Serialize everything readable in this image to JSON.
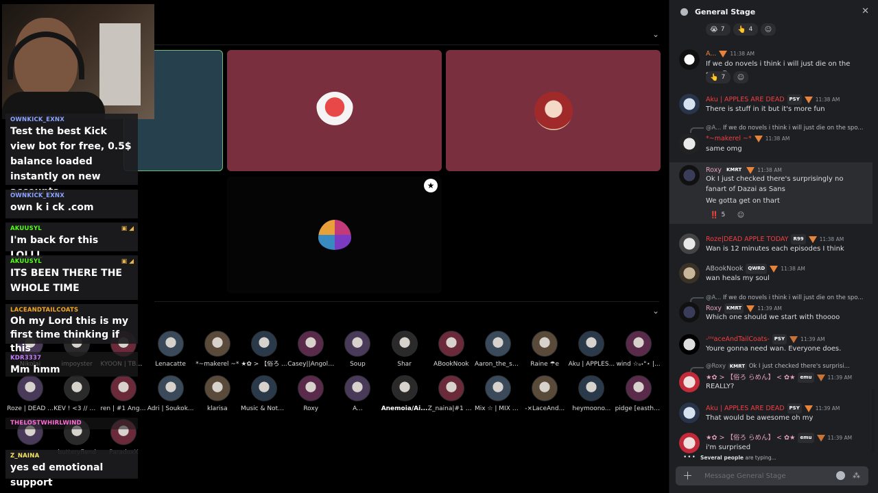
{
  "panel": {
    "title": "General Stage",
    "composer_placeholder": "Message General Stage",
    "typing_bold": "Several people",
    "typing_rest": "are typing..."
  },
  "top_reactions": [
    {
      "emoji": "😭",
      "count": "7"
    },
    {
      "emoji": "👆",
      "count": "4"
    }
  ],
  "messages": [
    {
      "name": "A...",
      "time": "11:38 AM",
      "text": "If we do novels i think i will just die on the spot😭",
      "reactions": [
        {
          "emoji": "👆",
          "count": "7"
        }
      ]
    },
    {
      "name": "Aku | APPLES ARE DEAD",
      "tag": "PSY",
      "time": "11:38 AM",
      "text": "There is stuff in it but it's more fun"
    },
    {
      "reply_name": "@A...",
      "reply_text": "If we do novels i think i will just die on the spo...",
      "name": "*~makerel ~*",
      "time": "11:38 AM",
      "text": "same omg"
    },
    {
      "name": "Roxy",
      "tag": "KMRT",
      "time": "11:38 AM",
      "text": "Ok I just checked there's surprisingly no fanart of Dazai as Sans",
      "text2": "We gotta get on thart",
      "reactions": [
        {
          "emoji": "‼️",
          "count": "5"
        }
      ]
    },
    {
      "name": "Roze|DEAD APPLE TODAY",
      "tag": "R99",
      "time": "11:38 AM",
      "text": "Wan is 12 minutes each episodes I think"
    },
    {
      "name": "ABookNook",
      "tag": "QWRD",
      "time": "11:38 AM",
      "text": "wan heals my soul"
    },
    {
      "reply_name": "@A...",
      "reply_text": "If we do novels i think i will just die on the spo...",
      "name": "Roxy",
      "tag": "KMRT",
      "time": "11:39 AM",
      "text": "Which one should we start with thoooo"
    },
    {
      "name": "-ᵗʰˡaceAndTailCoats-",
      "tag": "PSY",
      "time": "11:39 AM",
      "text": "Youre gonna need wan. Everyone does."
    },
    {
      "reply_name": "@Roxy",
      "reply_tag": "KMRT",
      "reply_text": "Ok I just checked there's surprisi...",
      "name": "★✿ > 【俗ろ らめん】 < ✿★",
      "tag": "emu",
      "time": "11:39 AM",
      "text": "REALLY?"
    },
    {
      "name": "Aku | APPLES ARE DEAD",
      "tag": "PSY",
      "time": "11:39 AM",
      "text": "That would be awesome oh my"
    },
    {
      "name": "★✿ > 【俗ろ らめん】 < ✿★",
      "tag": "emu",
      "time": "11:39 AM",
      "text": "i'm surprised"
    }
  ],
  "audience_row1": [
    "Nikolai",
    "impoyster",
    "KYOON | TBm...",
    "Lenacatte",
    "*~makerel ~*",
    "★✿ > 【俗ろ ...",
    "Casey||Angoli...",
    "Soup",
    "Shar",
    "ABookNook",
    "Aaron_the_sh...",
    "Raine ☂︎e",
    "Aku | APPLES...",
    "wind ☆ₒ˖°⋆ |..."
  ],
  "audience_row2": [
    "Roze | DEAD ...",
    "KEV ! <3 // MI...",
    "ren | #1 Angoli...",
    "Adri | Soukok...",
    "klarisa",
    "Music & Note...",
    "Roxy",
    "A...",
    "Anemoia/Ai...",
    "Z_naina|#1 Ed...",
    "Mix ☆ | MIX D...",
    "-×LaceAnd...",
    "heymoono...",
    "pidge [easthie..."
  ],
  "audience_row3": [
    "",
    "butteryfiend",
    "ParadoxX"
  ],
  "kick_chat": [
    {
      "user": "OWNKICK_EXNX",
      "text": "Test the best Kick view bot for free, 0.5$ balance loaded instantly on new accounts",
      "color": "#8aa4ff"
    },
    {
      "user": "OWNKICK_EXNX",
      "text": "own k i ck .com",
      "color": "#8aa4ff"
    },
    {
      "user": "AKUUSYL",
      "text": "I'm back for this LOLLL",
      "color": "#53fc18"
    },
    {
      "user": "AKUUSYL",
      "text": "ITS BEEN THERE THE WHOLE TIME",
      "color": "#53fc18"
    },
    {
      "user": "LACEANDTAILCOATS",
      "text": "Oh my Lord this is my first time thinking if this",
      "color": "#f5a623"
    },
    {
      "user": "KDR3337",
      "text": "Mm hmm",
      "color": "#c77dff"
    },
    {
      "user": "THELOSTWHIRLWIND",
      "text": "",
      "color": "#ff6bd6"
    },
    {
      "user": "Z_NAINA",
      "text": "yes ed emotional support",
      "color": "#f5e663"
    }
  ],
  "stage_colors": {
    "tile_teal": "#27404d",
    "tile_rose": "#7a2f3e",
    "accent_orange": "#e8833a"
  }
}
